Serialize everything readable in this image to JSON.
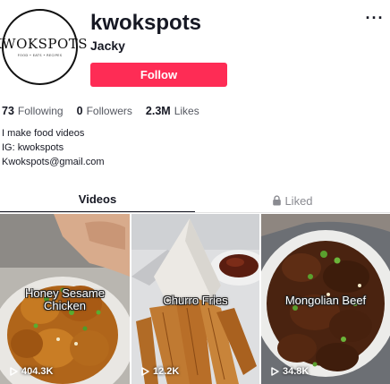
{
  "profile": {
    "avatar_logo_text": "KWOKSPOTS",
    "avatar_logo_subtext": "FOOD • EATS • RECIPES",
    "username": "kwokspots",
    "nickname": "Jacky",
    "follow_label": "Follow",
    "more_icon": "more-horizontal-icon"
  },
  "stats": [
    {
      "value": "73",
      "label": "Following"
    },
    {
      "value": "0",
      "label": "Followers"
    },
    {
      "value": "2.3M",
      "label": "Likes"
    }
  ],
  "bio": {
    "line1": "I make food videos",
    "line2": "IG: kwokspots",
    "line3": "Kwokspots@gmail.com"
  },
  "tabs": {
    "videos": "Videos",
    "liked": "Liked",
    "liked_icon": "lock-icon"
  },
  "videos": [
    {
      "caption_line1": "Honey Sesame",
      "caption_line2": "Chicken",
      "views": "404.3K",
      "play_icon": "play-icon"
    },
    {
      "caption_line1": "Churro Fries",
      "caption_line2": "",
      "views": "12.2K",
      "play_icon": "play-icon"
    },
    {
      "caption_line1": "Mongolian Beef",
      "caption_line2": "",
      "views": "34.8K",
      "play_icon": "play-icon"
    }
  ],
  "colors": {
    "accent": "#fe2c55",
    "text_primary": "#161823",
    "text_secondary": "#8a8b91"
  }
}
